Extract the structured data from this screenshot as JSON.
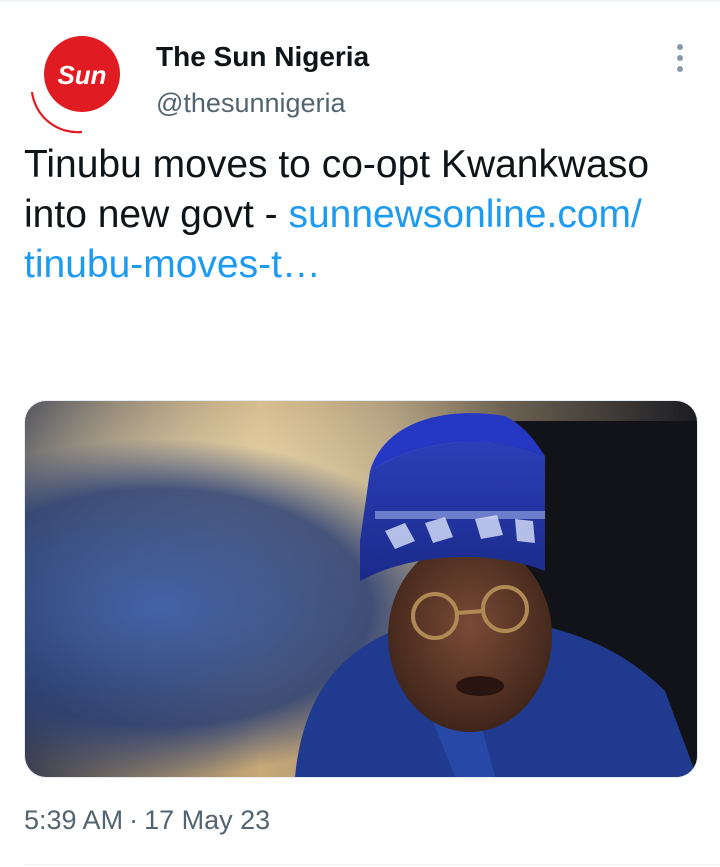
{
  "tweet": {
    "author": {
      "display_name": "The Sun Nigeria",
      "handle": "@thesunnigeria",
      "avatar_text": "Sun",
      "avatar_color": "#e01b22"
    },
    "text_main": "Tinubu moves to co-opt Kwankwaso into new govt -",
    "link_text": "sunnewsonline.com/​tinubu-moves-t…",
    "link_color": "#1d9bf0",
    "media_icon": "photo",
    "time": "5:39 AM",
    "separator": "·",
    "date": "17 May 23",
    "more_icon": "vertical-ellipsis-icon"
  }
}
